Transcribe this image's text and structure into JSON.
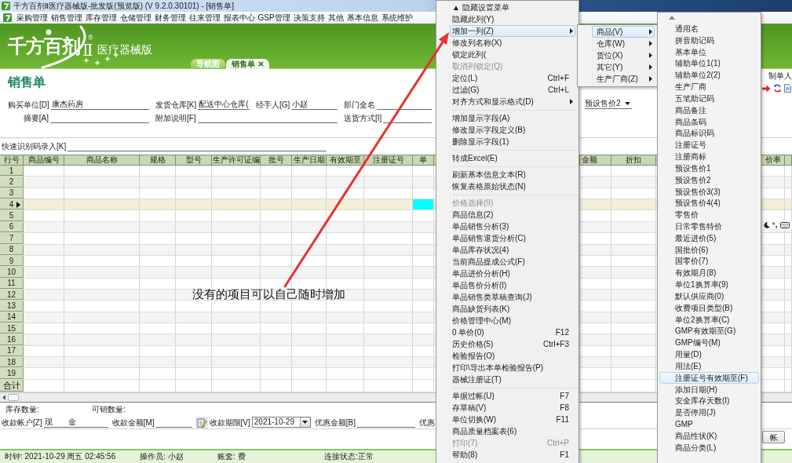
{
  "window": {
    "title": "千方百剂Ⅱ医疗器械版-批发版(预览版) (V 9.2.0.30101) - [销售单]"
  },
  "menu_bar": {
    "items": [
      "采购管理",
      "销售管理",
      "库存管理",
      "仓储管理",
      "财务管理",
      "往来管理",
      "报表中心",
      "GSP管理",
      "决策支持",
      "其他",
      "基本信息",
      "系统维护"
    ]
  },
  "banner": {
    "logo": {
      "name": "千方百剂",
      "numeral": "Ⅱ",
      "registered": "®",
      "edition": "医疗器械版"
    },
    "tabs": [
      {
        "label": "导航图",
        "selected": false,
        "closable": false
      },
      {
        "label": "销售单",
        "selected": true,
        "closable": true
      }
    ]
  },
  "document": {
    "title": "销售单",
    "maker_label": "制单人"
  },
  "form": {
    "fields": [
      {
        "label": "购买单位[D]",
        "value": "康杰药房"
      },
      {
        "label": "发货仓库[K]",
        "value": "配送中心仓库("
      },
      {
        "label": "经手人[G]",
        "value": "小赵"
      },
      {
        "label": "部门全名"
      },
      {
        "label": "摘要[A]"
      },
      {
        "label": "附加说明[F]"
      },
      {
        "label": "送货方式[I]"
      }
    ],
    "price_select": {
      "value": "预设售价2"
    },
    "quick_entry": {
      "label": "快速识别码录入[K]"
    }
  },
  "table": {
    "columns": [
      "行号",
      "商品编号",
      "商品名称",
      "规格",
      "型号",
      "生产许可证编",
      "批号",
      "生产日期",
      "有效期至",
      "注册证号",
      "单",
      "金额",
      "折扣",
      "价率"
    ],
    "rows": [
      {
        "number": "1",
        "selected": false
      },
      {
        "number": "2",
        "selected": false
      },
      {
        "number": "3",
        "selected": false
      },
      {
        "number": "4",
        "selected": true
      },
      {
        "number": "5",
        "selected": false
      },
      {
        "number": "6",
        "selected": false
      },
      {
        "number": "7",
        "selected": false
      },
      {
        "number": "8",
        "selected": false
      },
      {
        "number": "9",
        "selected": false
      },
      {
        "number": "10",
        "selected": false
      },
      {
        "number": "11",
        "selected": false
      },
      {
        "number": "12",
        "selected": false
      },
      {
        "number": "13",
        "selected": false
      },
      {
        "number": "14",
        "selected": false
      },
      {
        "number": "15",
        "selected": false
      },
      {
        "number": "16",
        "selected": false
      },
      {
        "number": "17",
        "selected": false
      },
      {
        "number": "18",
        "selected": false
      },
      {
        "number": "19",
        "selected": false
      }
    ],
    "total_label": "合计"
  },
  "summary": {
    "items": [
      "库存数量:",
      "可销数量:"
    ]
  },
  "payment": {
    "fields": [
      {
        "kind": "text",
        "label": "收款帐户[Z]",
        "value": "现　　金"
      },
      {
        "kind": "text",
        "label": "收款金额[M]"
      },
      {
        "kind": "date",
        "label": "收款期限[V]",
        "value": "2021-10-29"
      },
      {
        "kind": "text",
        "label": "优惠金额[B]"
      }
    ],
    "trailing_label": "优惠"
  },
  "action_buttons": [
    {
      "label": "帐"
    }
  ],
  "status_bar": {
    "items": [
      "时钟: 2021-10-29 周五 02:45:56",
      "操作员: 小赵",
      "账套: 费",
      "连接状态:正常"
    ]
  },
  "context_menu": {
    "groups": [
      [
        {
          "label": "▲ 隐藏设置菜单",
          "selected": false,
          "disabled": false,
          "submenu": false
        },
        {
          "label": "隐藏此列(Y)",
          "selected": false,
          "disabled": false,
          "submenu": false
        },
        {
          "label": "增加一列(Z)",
          "selected": true,
          "disabled": false,
          "submenu": true
        },
        {
          "label": "修改列名称(X)",
          "selected": false,
          "disabled": false,
          "submenu": false
        },
        {
          "label": "锁定此列(",
          "selected": false,
          "disabled": false,
          "submenu": false
        },
        {
          "label": "取消列锁定(Q)",
          "selected": false,
          "disabled": true,
          "submenu": false
        },
        {
          "label": "定位(L)",
          "shortcut": "Ctrl+F",
          "selected": false,
          "disabled": false,
          "submenu": false
        },
        {
          "label": "过滤(G)",
          "shortcut": "Ctrl+L",
          "selected": false,
          "disabled": false,
          "submenu": false
        },
        {
          "label": "对齐方式和显示格式(D)",
          "selected": false,
          "disabled": false,
          "submenu": true
        }
      ],
      [
        {
          "label": "增加显示字段(A)",
          "selected": false,
          "disabled": false,
          "submenu": false
        },
        {
          "label": "修改显示字段定义(B)",
          "selected": false,
          "disabled": false,
          "submenu": false
        },
        {
          "label": "删除显示字段(1)",
          "selected": false,
          "disabled": false,
          "submenu": false
        }
      ],
      [
        {
          "label": "转成Excel(E)",
          "selected": false,
          "disabled": false,
          "submenu": false
        }
      ],
      [
        {
          "label": "刷新基本信息文本(R)",
          "selected": false,
          "disabled": false,
          "submenu": false
        },
        {
          "label": "恢复表格原始状态(N)",
          "selected": false,
          "disabled": false,
          "submenu": false
        }
      ],
      [
        {
          "label": "价格选择(9)",
          "selected": false,
          "disabled": true,
          "submenu": false
        },
        {
          "label": "商品信息(2)",
          "selected": false,
          "disabled": false,
          "submenu": false
        },
        {
          "label": "单品销售分析(3)",
          "selected": false,
          "disabled": false,
          "submenu": false
        },
        {
          "label": "单品销售退货分析(C)",
          "selected": false,
          "disabled": false,
          "submenu": false
        },
        {
          "label": "单品库存状况(4)",
          "selected": false,
          "disabled": false,
          "submenu": false
        },
        {
          "label": "当前商品提成公式(F)",
          "selected": false,
          "disabled": false,
          "submenu": false
        },
        {
          "label": "单品进价分析(H)",
          "selected": false,
          "disabled": false,
          "submenu": false
        },
        {
          "label": "单品售价分析(I)",
          "selected": false,
          "disabled": false,
          "submenu": false
        },
        {
          "label": "单品销售类草稿查询(J)",
          "selected": false,
          "disabled": false,
          "submenu": false
        },
        {
          "label": "商品缺货列表(K)",
          "selected": false,
          "disabled": false,
          "submenu": false
        },
        {
          "label": "价格管理中心(M)",
          "selected": false,
          "disabled": false,
          "submenu": false
        },
        {
          "label": "0 单价(0)",
          "shortcut": "F12",
          "selected": false,
          "disabled": false,
          "submenu": false
        },
        {
          "label": "历史价格(5)",
          "shortcut": "Ctrl+F3",
          "selected": false,
          "disabled": false,
          "submenu": false
        },
        {
          "label": "检验报告(O)",
          "selected": false,
          "disabled": false,
          "submenu": false
        },
        {
          "label": "打印\\导出本单检验报告(P)",
          "selected": false,
          "disabled": false,
          "submenu": false
        },
        {
          "label": "器械注册证(T)",
          "selected": false,
          "disabled": false,
          "submenu": false
        }
      ],
      [
        {
          "label": "单据过帐(U)",
          "shortcut": "F7",
          "selected": false,
          "disabled": false,
          "submenu": false
        },
        {
          "label": "存草稿(V)",
          "shortcut": "F8",
          "selected": false,
          "disabled": false,
          "submenu": false
        },
        {
          "label": "单位切换(W)",
          "shortcut": "F11",
          "selected": false,
          "disabled": false,
          "submenu": false
        },
        {
          "label": "商品质量档案表(6)",
          "selected": false,
          "disabled": false,
          "submenu": false
        },
        {
          "label": "打印(7)",
          "shortcut": "Ctrl+P",
          "selected": false,
          "disabled": true,
          "submenu": false
        },
        {
          "label": "帮助(8)",
          "shortcut": "F1",
          "selected": false,
          "disabled": false,
          "submenu": false
        }
      ]
    ]
  },
  "column_submenu": {
    "items": [
      {
        "label": "商品(V)",
        "selected": true,
        "submenu": true
      },
      {
        "label": "仓库(W)",
        "selected": false,
        "submenu": true
      },
      {
        "label": "货位(X)",
        "selected": false,
        "submenu": true
      },
      {
        "label": "其它(Y)",
        "selected": false,
        "submenu": true
      },
      {
        "label": "生产厂商(Z)",
        "selected": false,
        "submenu": true
      }
    ]
  },
  "field_submenu": {
    "items": [
      {
        "label": "通用名",
        "selected": false
      },
      {
        "label": "拼音助记码",
        "selected": false
      },
      {
        "label": "基本单位",
        "selected": false
      },
      {
        "label": "辅助单位1(1)",
        "selected": false
      },
      {
        "label": "辅助单位2(2)",
        "selected": false
      },
      {
        "label": "生产厂商",
        "selected": false
      },
      {
        "label": "五笔助记码",
        "selected": false
      },
      {
        "label": "商品备注",
        "selected": false
      },
      {
        "label": "商品条码",
        "selected": false
      },
      {
        "label": "商品标识码",
        "selected": false
      },
      {
        "label": "注册证号",
        "selected": false
      },
      {
        "label": "注册商标",
        "selected": false
      },
      {
        "label": "预设售价1",
        "selected": false
      },
      {
        "label": "预设售价2",
        "selected": false
      },
      {
        "label": "预设售价3(3)",
        "selected": false
      },
      {
        "label": "预设售价4(4)",
        "selected": false
      },
      {
        "label": "零售价",
        "selected": false
      },
      {
        "label": "日常零售特价",
        "selected": false
      },
      {
        "label": "最近进价(5)",
        "selected": false
      },
      {
        "label": "国批价(6)",
        "selected": false
      },
      {
        "label": "国零价(7)",
        "selected": false
      },
      {
        "label": "有效期月(8)",
        "selected": false
      },
      {
        "label": "单位1换算率(9)",
        "selected": false
      },
      {
        "label": "默认供应商(0)",
        "selected": false
      },
      {
        "label": "收费项目类型(B)",
        "selected": false
      },
      {
        "label": "单位2换算率(C)",
        "selected": false
      },
      {
        "label": "GMP有效期至(G)",
        "selected": false
      },
      {
        "label": "GMP编号(M)",
        "selected": false
      },
      {
        "label": "用量(D)",
        "selected": false
      },
      {
        "label": "用法(E)",
        "selected": false
      },
      {
        "label": "注册证号有效期至(F)",
        "selected": true
      },
      {
        "label": "添加日期(H)",
        "selected": false
      },
      {
        "label": "安全库存天数(I)",
        "selected": false
      },
      {
        "label": "是否停用(J)",
        "selected": false
      },
      {
        "label": "GMP",
        "selected": false
      },
      {
        "label": "商品性状(K)",
        "selected": false
      },
      {
        "label": "商品分类(L)",
        "selected": false
      }
    ]
  },
  "annotation": {
    "text": "没有的项目可以自己随时增加"
  }
}
